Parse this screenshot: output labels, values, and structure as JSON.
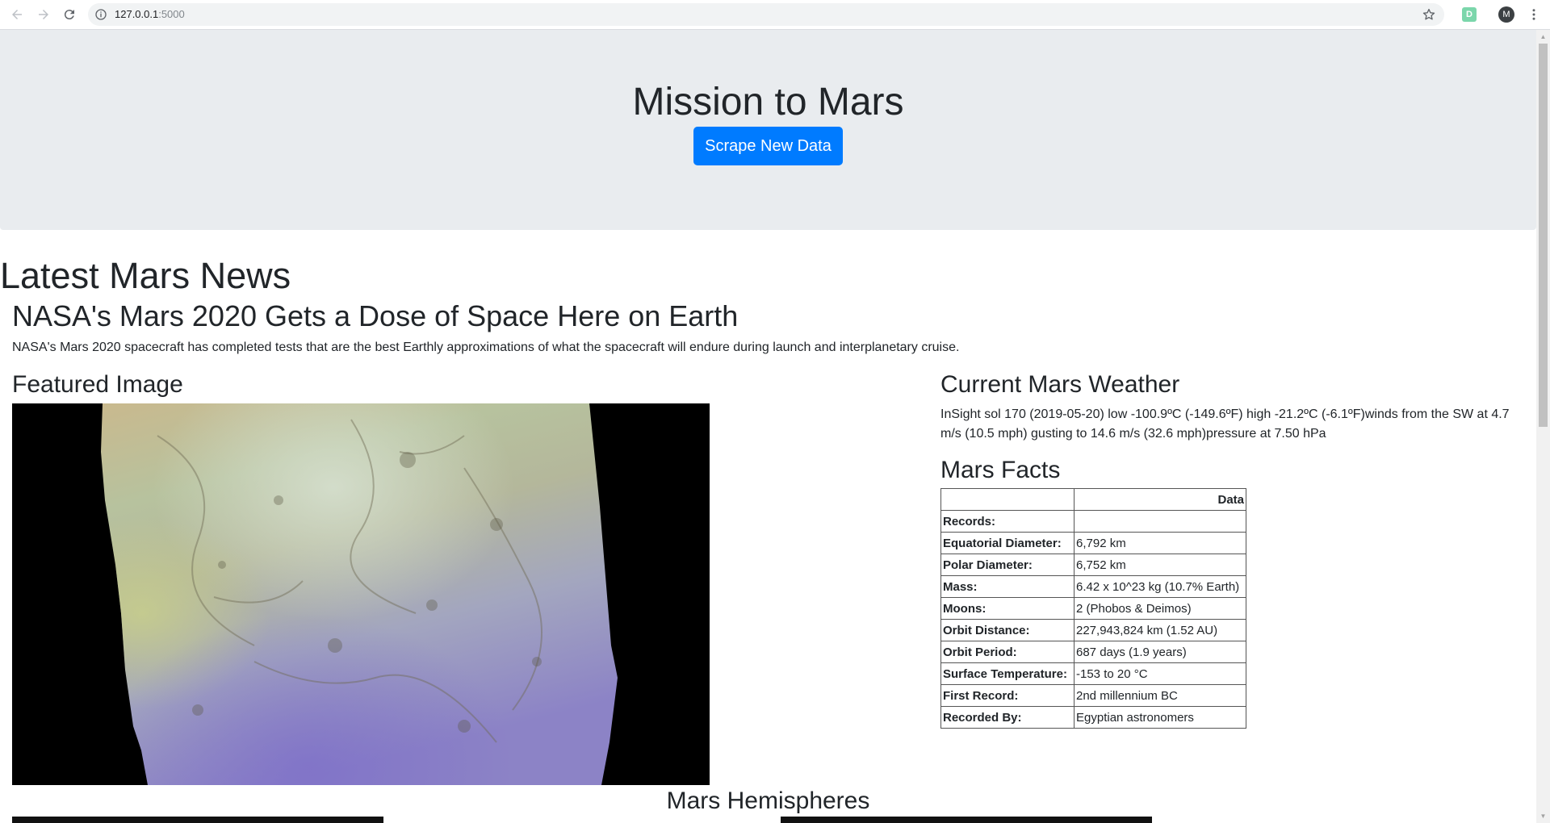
{
  "browser": {
    "url_host": "127.0.0.1",
    "url_port": ":5000",
    "extension_letter": "D",
    "profile_initial": "M",
    "icons": [
      "back-icon",
      "forward-icon",
      "reload-icon",
      "info-icon",
      "star-icon",
      "menu-icon"
    ]
  },
  "header": {
    "title": "Mission to Mars",
    "button_label": "Scrape New Data",
    "button_color": "#007bff"
  },
  "news": {
    "section_title": "Latest Mars News",
    "headline": "NASA's Mars 2020 Gets a Dose of Space Here on Earth",
    "paragraph": "NASA's Mars 2020 spacecraft has completed tests that are the best Earthly approximations of what the spacecraft will endure during launch and interplanetary cruise."
  },
  "featured": {
    "section_title": "Featured Image"
  },
  "weather": {
    "section_title": "Current Mars Weather",
    "text": "InSight sol 170 (2019-05-20) low -100.9ºC (-149.6ºF) high -21.2ºC (-6.1ºF)winds from the SW at 4.7 m/s (10.5 mph) gusting to 14.6 m/s (32.6 mph)pressure at 7.50 hPa"
  },
  "facts": {
    "section_title": "Mars Facts",
    "header": [
      "",
      "Data"
    ],
    "rows": [
      {
        "label": "Records:",
        "value": ""
      },
      {
        "label": "Equatorial Diameter:",
        "value": "6,792 km"
      },
      {
        "label": "Polar Diameter:",
        "value": "6,752 km"
      },
      {
        "label": "Mass:",
        "value": "6.42 x 10^23 kg (10.7% Earth)"
      },
      {
        "label": "Moons:",
        "value": "2 (Phobos & Deimos)"
      },
      {
        "label": "Orbit Distance:",
        "value": "227,943,824 km (1.52 AU)"
      },
      {
        "label": "Orbit Period:",
        "value": "687 days (1.9 years)"
      },
      {
        "label": "Surface Temperature:",
        "value": "-153 to 20 °C"
      },
      {
        "label": "First Record:",
        "value": "2nd millennium BC"
      },
      {
        "label": "Recorded By:",
        "value": "Egyptian astronomers"
      }
    ]
  },
  "hemispheres": {
    "section_title": "Mars Hemispheres"
  }
}
